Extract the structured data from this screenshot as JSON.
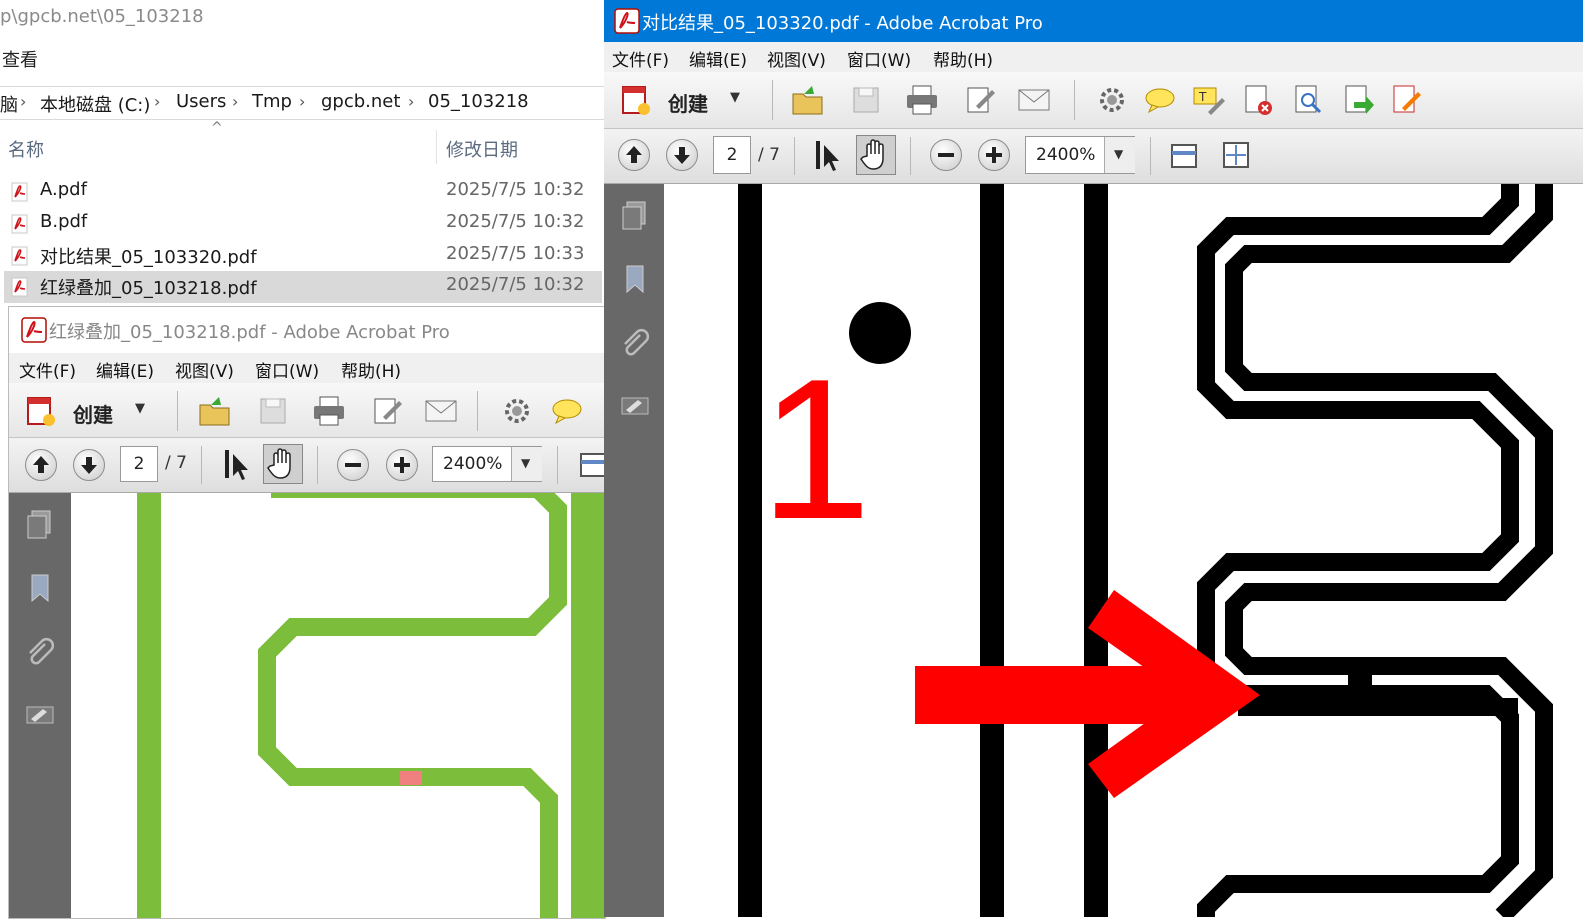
{
  "explorer": {
    "path_fragment": "p\\gpcb.net\\05_103218",
    "menu_view": "查看",
    "breadcrumbs": [
      "脑",
      "本地磁盘 (C:)",
      "Users",
      "Tmp",
      "gpcb.net",
      "05_103218"
    ],
    "columns": {
      "name": "名称",
      "date": "修改日期"
    },
    "files": [
      {
        "name": "A.pdf",
        "date": "2025/7/5 10:32"
      },
      {
        "name": "B.pdf",
        "date": "2025/7/5 10:32"
      },
      {
        "name": "对比结果_05_103320.pdf",
        "date": "2025/7/5 10:33"
      },
      {
        "name": "红绿叠加_05_103218.pdf",
        "date": "2025/7/5 10:32",
        "selected": true
      }
    ]
  },
  "acrobat_main": {
    "title": "对比结果_05_103320.pdf - Adobe Acrobat Pro",
    "titlebar_color": "#0078d7",
    "menu": [
      "文件(F)",
      "编辑(E)",
      "视图(V)",
      "窗口(W)",
      "帮助(H)"
    ],
    "create_label": "创建",
    "page_current": "2",
    "page_total": "/ 7",
    "zoom": "2400%",
    "marker_text": "1",
    "marker_color": "#ff0000"
  },
  "acrobat_back": {
    "title": "红绿叠加_05_103218.pdf - Adobe Acrobat Pro",
    "menu": [
      "文件(F)",
      "编辑(E)",
      "视图(V)",
      "窗口(W)",
      "帮助(H)"
    ],
    "create_label": "创建",
    "page_current": "2",
    "page_total": "/ 7",
    "zoom": "2400%",
    "trace_color": "#7cbd3c",
    "diff_color": "#f08080"
  }
}
